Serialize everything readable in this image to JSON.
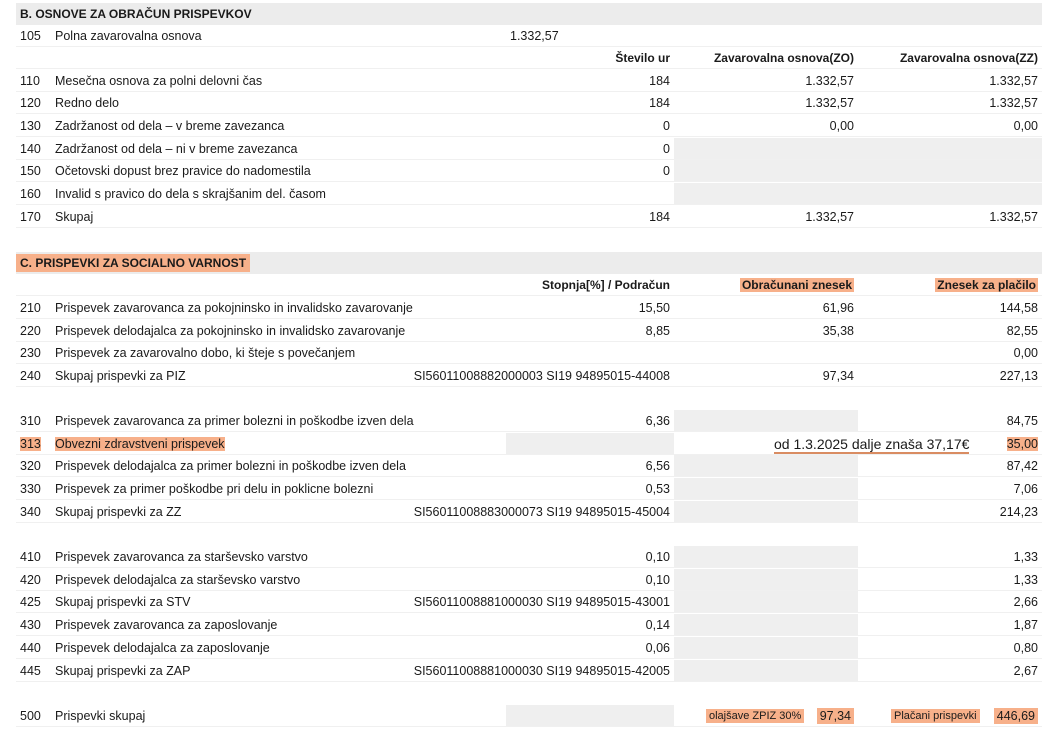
{
  "sectionB": {
    "title": "B. OSNOVE ZA OBRAČUN PRISPEVKOV",
    "row105": {
      "code": "105",
      "label": "Polna zavarovalna osnova",
      "value": "1.332,57"
    },
    "headers": {
      "hours": "Število ur",
      "zo": "Zavarovalna osnova(ZO)",
      "zz": "Zavarovalna osnova(ZZ)"
    },
    "rows": [
      {
        "code": "110",
        "label": "Mesečna osnova za polni delovni čas",
        "hours": "184",
        "zo": "1.332,57",
        "zz": "1.332,57"
      },
      {
        "code": "120",
        "label": "Redno delo",
        "hours": "184",
        "zo": "1.332,57",
        "zz": "1.332,57"
      },
      {
        "code": "130",
        "label": "Zadržanost od dela – v breme zavezanca",
        "hours": "0",
        "zo": "0,00",
        "zz": "0,00"
      },
      {
        "code": "140",
        "label": "Zadržanost od dela – ni v breme zavezanca",
        "hours": "0",
        "zo": "",
        "zz": ""
      },
      {
        "code": "150",
        "label": "Očetovski dopust brez pravice do nadomestila",
        "hours": "0",
        "zo": "",
        "zz": ""
      },
      {
        "code": "160",
        "label": "Invalid s pravico do dela s skrajšanim del. časom",
        "hours": "",
        "zo": "",
        "zz": ""
      },
      {
        "code": "170",
        "label": "Skupaj",
        "hours": "184",
        "zo": "1.332,57",
        "zz": "1.332,57"
      }
    ]
  },
  "sectionC": {
    "title": "C. PRISPEVKI ZA SOCIALNO VARNOST",
    "headers": {
      "rate": "Stopnja[%] / Podračun",
      "calc": "Obračunani znesek",
      "pay": "Znesek za plačilo"
    },
    "rows": [
      {
        "code": "210",
        "label": "Prispevek zavarovanca za pokojninsko in invalidsko zavarovanje",
        "rate": "15,50",
        "calc": "61,96",
        "pay": "144,58"
      },
      {
        "code": "220",
        "label": "Prispevek delodajalca za pokojninsko in invalidsko zavarovanje",
        "rate": "8,85",
        "calc": "35,38",
        "pay": "82,55"
      },
      {
        "code": "230",
        "label": "Prispevek za zavarovalno dobo, ki šteje s povečanjem",
        "rate": "",
        "calc": "",
        "pay": "0,00"
      },
      {
        "code": "240",
        "label": "Skupaj prispevki za PIZ",
        "rate": "SI56011008882000003 SI19 94895015-44008",
        "calc": "97,34",
        "pay": "227,13"
      },
      {
        "code": "310",
        "label": "Prispevek zavarovanca za primer bolezni in poškodbe izven dela",
        "rate": "6,36",
        "calc": "",
        "pay": "84,75"
      },
      {
        "code": "313",
        "label": "Obvezni zdravstveni prispevek",
        "rate": "",
        "calc": "",
        "pay": "35,00"
      },
      {
        "code": "320",
        "label": "Prispevek delodajalca za primer bolezni in poškodbe izven dela",
        "rate": "6,56",
        "calc": "",
        "pay": "87,42"
      },
      {
        "code": "330",
        "label": "Prispevek za primer poškodbe pri delu in poklicne bolezni",
        "rate": "0,53",
        "calc": "",
        "pay": "7,06"
      },
      {
        "code": "340",
        "label": "Skupaj prispevki za ZZ",
        "rate": "SI56011008883000073 SI19 94895015-45004",
        "calc": "",
        "pay": "214,23"
      },
      {
        "code": "410",
        "label": "Prispevek zavarovanca za starševsko varstvo",
        "rate": "0,10",
        "calc": "",
        "pay": "1,33"
      },
      {
        "code": "420",
        "label": "Prispevek delodajalca za starševsko varstvo",
        "rate": "0,10",
        "calc": "",
        "pay": "1,33"
      },
      {
        "code": "425",
        "label": "Skupaj prispevki za STV",
        "rate": "SI56011008881000030 SI19 94895015-43001",
        "calc": "",
        "pay": "2,66"
      },
      {
        "code": "430",
        "label": "Prispevek zavarovanca za zaposlovanje",
        "rate": "0,14",
        "calc": "",
        "pay": "1,87"
      },
      {
        "code": "440",
        "label": "Prispevek delodajalca za zaposlovanje",
        "rate": "0,06",
        "calc": "",
        "pay": "0,80"
      },
      {
        "code": "445",
        "label": "Skupaj prispevki za ZAP",
        "rate": "SI56011008881000030 SI19 94895015-42005",
        "calc": "",
        "pay": "2,67"
      }
    ],
    "note313": "od 1.3.2025 dalje znaša 37,17€",
    "total": {
      "code": "500",
      "label": "Prispevki skupaj",
      "relief_label": "olajšave ZPIZ 30%",
      "relief_value": "97,34",
      "paid_label": "Plačani prispevki",
      "paid_value": "446,69"
    }
  }
}
